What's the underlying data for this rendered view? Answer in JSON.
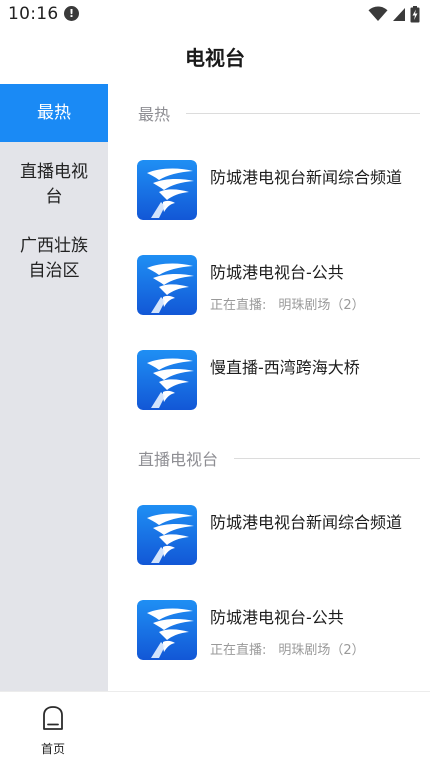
{
  "status_bar": {
    "time": "10:16",
    "alert": "!"
  },
  "header": {
    "title": "电视台"
  },
  "sidebar": {
    "items": [
      {
        "label": "最热",
        "active": true
      },
      {
        "label": "直播电视台",
        "active": false
      },
      {
        "label": "广西壮族自治区",
        "active": false
      }
    ]
  },
  "content": {
    "sections": [
      {
        "title": "最热",
        "channels": [
          {
            "name": "防城港电视台新闻综合频道"
          },
          {
            "name": "防城港电视台-公共",
            "now_playing_label": "正在直播:",
            "now_playing": "明珠剧场（2）"
          },
          {
            "name": "慢直播-西湾跨海大桥"
          }
        ]
      },
      {
        "title": "直播电视台",
        "channels": [
          {
            "name": "防城港电视台新闻综合频道"
          },
          {
            "name": "防城港电视台-公共",
            "now_playing_label": "正在直播:",
            "now_playing": "明珠剧场（2）"
          }
        ]
      }
    ]
  },
  "bottom_nav": {
    "items": [
      {
        "label": "首页",
        "icon": "home-icon"
      }
    ]
  },
  "colors": {
    "accent": "#1a8af5",
    "sidebar_bg": "#e3e4e9",
    "muted_text": "#8e8e93",
    "logo_blue": "#1b6fe0"
  }
}
